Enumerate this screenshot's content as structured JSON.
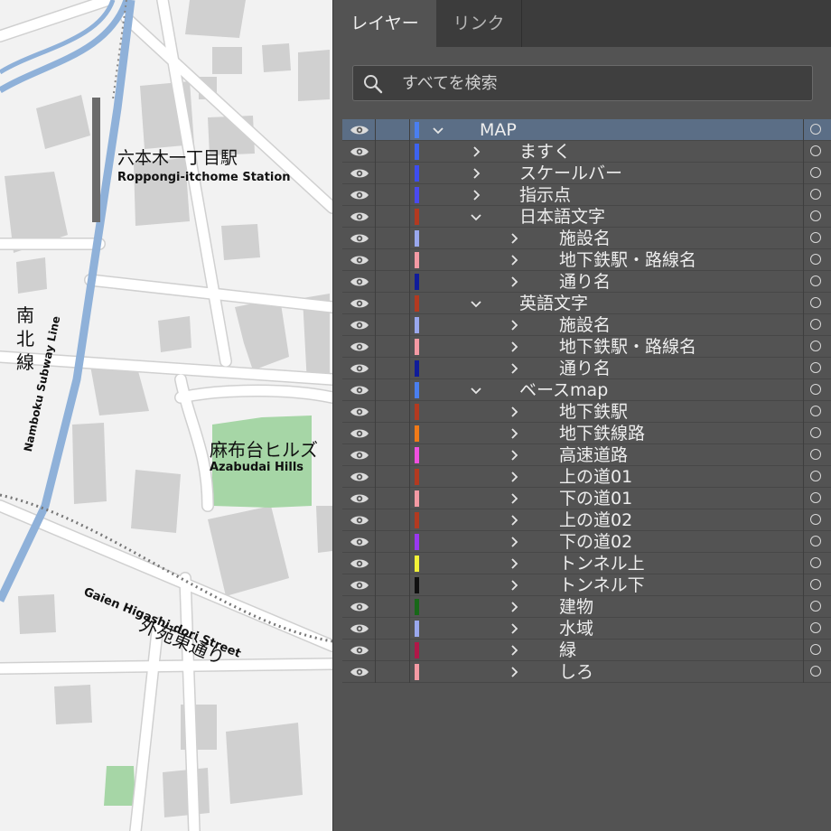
{
  "map": {
    "labels": {
      "station_jp": "六本木一丁目駅",
      "station_en": "Roppongi-itchome Station",
      "subway_jp": "南北線",
      "subway_en": "Namboku Subway Line",
      "hills_jp": "麻布台ヒルズ",
      "hills_en": "Azabudai Hills",
      "street_jp": "外苑東通り",
      "street_en": "Gaien Higashi-dori Street"
    },
    "colors": {
      "background": "#f2f2f2",
      "road": "#ffffff",
      "road_outline": "#d0d0d0",
      "building": "#d0d0d0",
      "park": "#a6d6a6",
      "subway": "#8fb1d9",
      "rail_dots": "#888888"
    }
  },
  "panel": {
    "tabs": [
      {
        "label": "レイヤー",
        "active": true
      },
      {
        "label": "リンク",
        "active": false
      }
    ],
    "search": {
      "placeholder": "すべてを検索",
      "icon": "search-icon"
    },
    "layers": [
      {
        "name": "MAP",
        "color": "#4a7ff0",
        "depth": 0,
        "expanded": true,
        "selected": true
      },
      {
        "name": "ますく",
        "color": "#3d63f0",
        "depth": 1,
        "expanded": false
      },
      {
        "name": "スケールバー",
        "color": "#3d4df0",
        "depth": 1,
        "expanded": false
      },
      {
        "name": "指示点",
        "color": "#4a4af0",
        "depth": 1,
        "expanded": false
      },
      {
        "name": "日本語文字",
        "color": "#b33a20",
        "depth": 1,
        "expanded": true
      },
      {
        "name": "施設名",
        "color": "#9aa8ee",
        "depth": 2,
        "expanded": false
      },
      {
        "name": "地下鉄駅・路線名",
        "color": "#f49aa4",
        "depth": 2,
        "expanded": false
      },
      {
        "name": "通り名",
        "color": "#101c9a",
        "depth": 2,
        "expanded": false
      },
      {
        "name": "英語文字",
        "color": "#b33a20",
        "depth": 1,
        "expanded": true
      },
      {
        "name": "施設名",
        "color": "#9aa8ee",
        "depth": 2,
        "expanded": false
      },
      {
        "name": "地下鉄駅・路線名",
        "color": "#f49aa4",
        "depth": 2,
        "expanded": false
      },
      {
        "name": "通り名",
        "color": "#101c9a",
        "depth": 2,
        "expanded": false
      },
      {
        "name": "ベースmap",
        "color": "#4a7ff0",
        "depth": 1,
        "expanded": true
      },
      {
        "name": "地下鉄駅",
        "color": "#b33a20",
        "depth": 2,
        "expanded": false
      },
      {
        "name": "地下鉄線路",
        "color": "#f07a18",
        "depth": 2,
        "expanded": false
      },
      {
        "name": "高速道路",
        "color": "#f050e0",
        "depth": 2,
        "expanded": false
      },
      {
        "name": "上の道01",
        "color": "#b33a20",
        "depth": 2,
        "expanded": false
      },
      {
        "name": "下の道01",
        "color": "#f49aa4",
        "depth": 2,
        "expanded": false
      },
      {
        "name": "上の道02",
        "color": "#b33a20",
        "depth": 2,
        "expanded": false
      },
      {
        "name": "下の道02",
        "color": "#9a38f0",
        "depth": 2,
        "expanded": false
      },
      {
        "name": "トンネル上",
        "color": "#f2f238",
        "depth": 2,
        "expanded": false
      },
      {
        "name": "トンネル下",
        "color": "#101010",
        "depth": 2,
        "expanded": false
      },
      {
        "name": "建物",
        "color": "#186818",
        "depth": 2,
        "expanded": false
      },
      {
        "name": "水域",
        "color": "#9aa8ee",
        "depth": 2,
        "expanded": false
      },
      {
        "name": "緑",
        "color": "#b01848",
        "depth": 2,
        "expanded": false
      },
      {
        "name": "しろ",
        "color": "#f49aa4",
        "depth": 2,
        "expanded": false
      }
    ]
  }
}
